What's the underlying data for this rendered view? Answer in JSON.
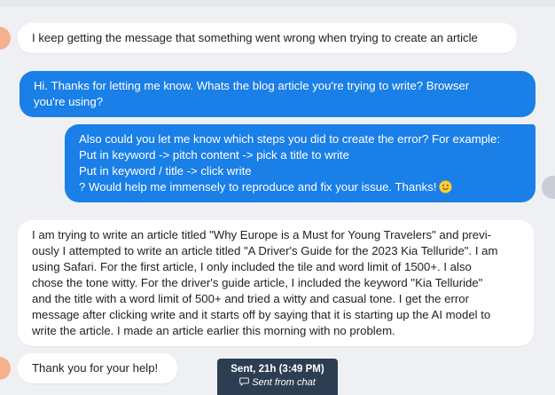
{
  "messages": [
    {
      "role": "user",
      "lines": [
        "I keep getting the message that something went wrong when trying to create an article"
      ]
    },
    {
      "role": "agent",
      "lines": [
        "Hi. Thanks for letting me know. Whats the blog article you're trying to write? Browser",
        "you're using?"
      ]
    },
    {
      "role": "agent",
      "lines": [
        "Also could you let me know which steps you did to create the error? For example:",
        "Put in keyword -> pitch content -> pick a title to write",
        "Put in keyword / title -> click write",
        "? Would help me immensely to reproduce and fix your issue. Thanks!"
      ],
      "emoji": "slightly-smiling-face-icon"
    },
    {
      "role": "user",
      "lines": [
        "I am trying to write an article titled \"Why Europe is a Must for Young Travelers\" and previ-",
        "ously I attempted to write an article titled \"A Driver's Guide for the 2023 Kia Telluride\". I am",
        "using Safari. For the first article, I only included the tile and word limit of 1500+. I also",
        "chose the tone witty. For the driver's guide article, I included the keyword \"Kia Telluride\"",
        "and the title with a word limit of 500+ and tried a witty and casual tone. I get the error",
        "message after clicking write and it starts off by saying that it is starting up the AI model to",
        "write the article. I made an article earlier this morning with no problem."
      ]
    },
    {
      "role": "user",
      "lines": [
        "Thank you for your help!"
      ]
    }
  ],
  "tooltip": {
    "sent": "Sent, 21h (3:49 PM)",
    "via": "Sent from chat",
    "icon": "chat-bubble-icon"
  },
  "colors": {
    "background": "#eef0f3",
    "outgoing_bubble": "#1a7fe6",
    "incoming_bubble": "#ffffff",
    "tooltip": "#2d3e52"
  }
}
